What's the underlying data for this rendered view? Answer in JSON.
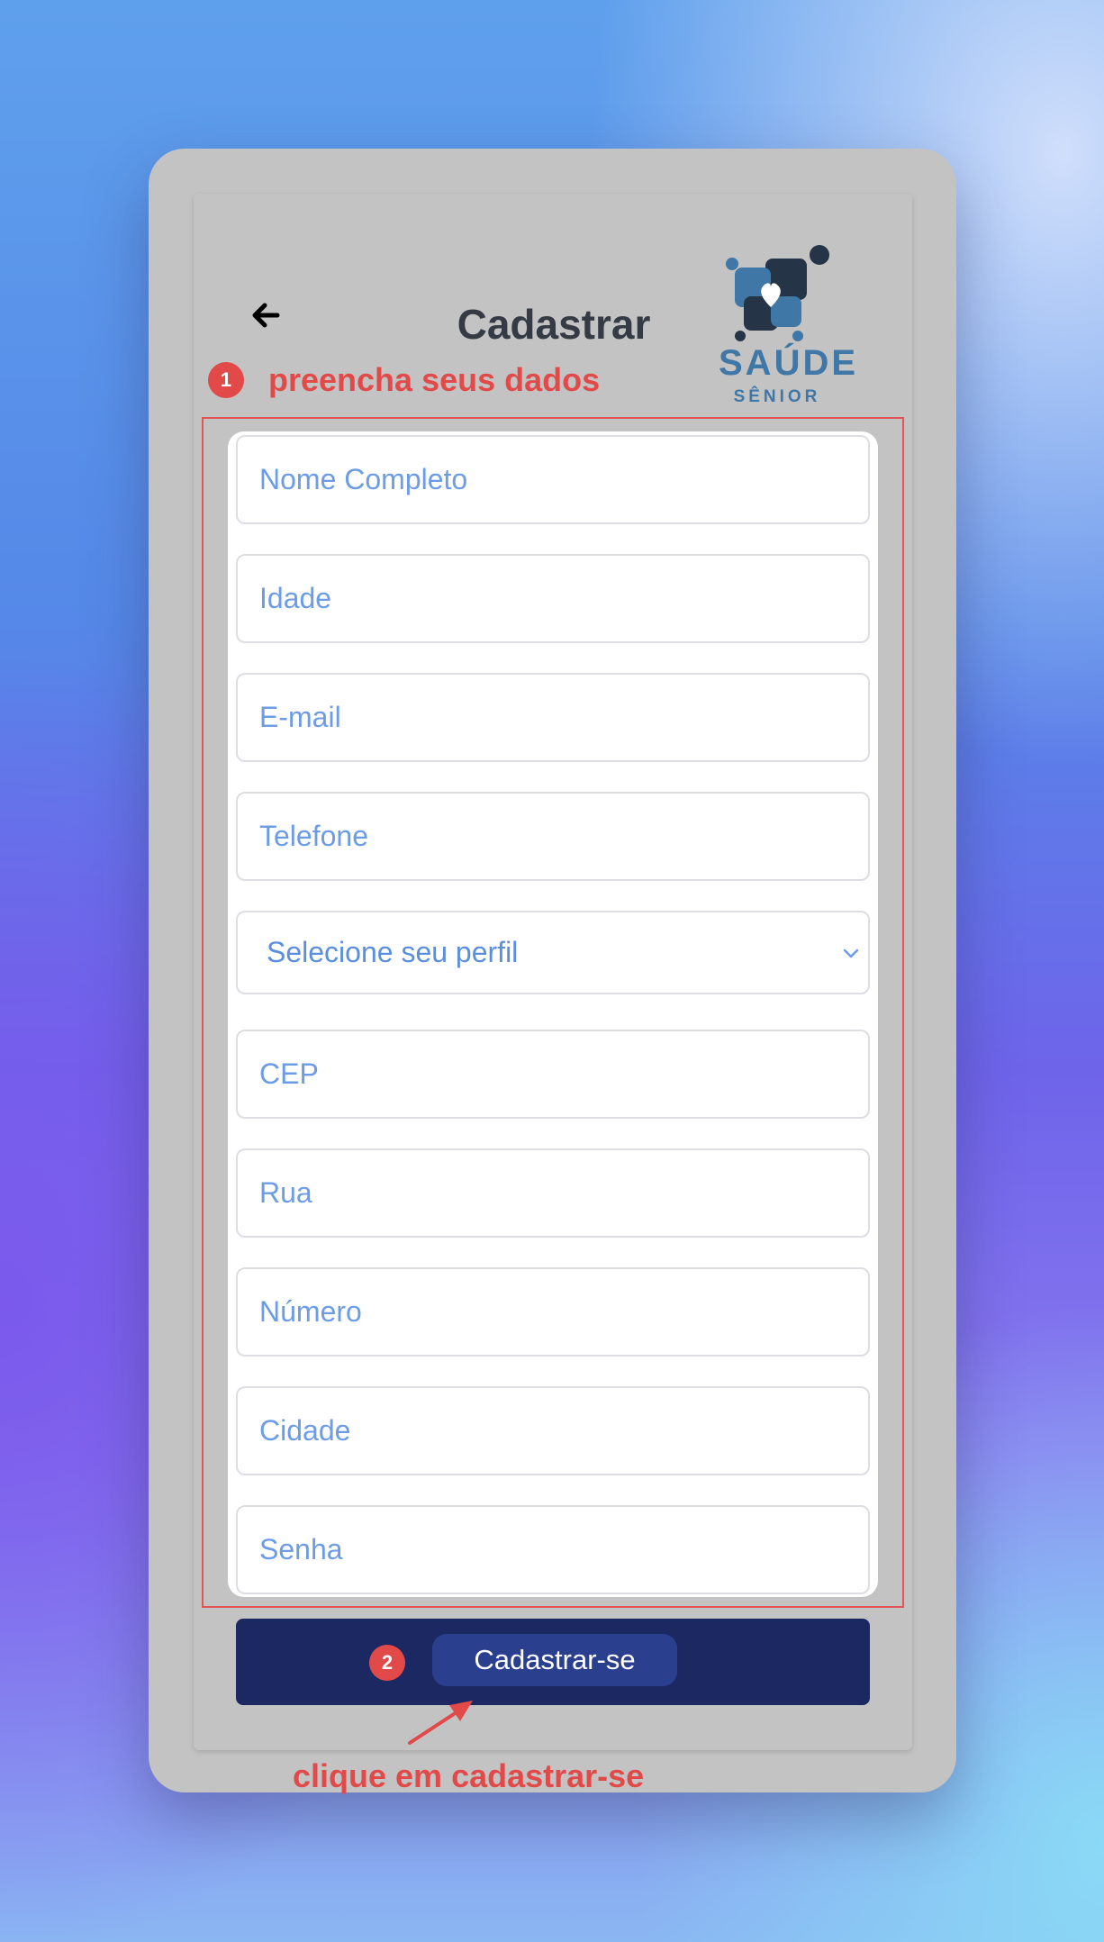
{
  "header": {
    "back_icon": "arrow-left-icon",
    "title": "Cadastrar",
    "logo": {
      "name": "SAÚDE",
      "subtitle": "SÊNIOR",
      "colors": {
        "dark": "#253447",
        "blue": "#3f77a7"
      }
    }
  },
  "annotations": {
    "step1": {
      "number": "1",
      "text": "preencha seus dados"
    },
    "step2": {
      "number": "2",
      "text": "clique em cadastrar-se"
    },
    "color": "#e24a4a"
  },
  "form": {
    "fields": {
      "nome": {
        "placeholder": "Nome Completo",
        "value": ""
      },
      "idade": {
        "placeholder": "Idade",
        "value": ""
      },
      "email": {
        "placeholder": "E-mail",
        "value": ""
      },
      "telefone": {
        "placeholder": "Telefone",
        "value": ""
      },
      "cep": {
        "placeholder": "CEP",
        "value": ""
      },
      "rua": {
        "placeholder": "Rua",
        "value": ""
      },
      "numero": {
        "placeholder": "Número",
        "value": ""
      },
      "cidade": {
        "placeholder": "Cidade",
        "value": ""
      },
      "senha": {
        "placeholder": "Senha",
        "value": ""
      }
    },
    "perfil": {
      "label": "Selecione seu perfil",
      "icon": "chevron-down-icon"
    },
    "submit_label": "Cadastrar-se"
  },
  "colors": {
    "placeholder": "#6d9ce6",
    "submit_bar": "#1c2862",
    "submit_button": "#2b3f8f",
    "title": "#353b45"
  }
}
